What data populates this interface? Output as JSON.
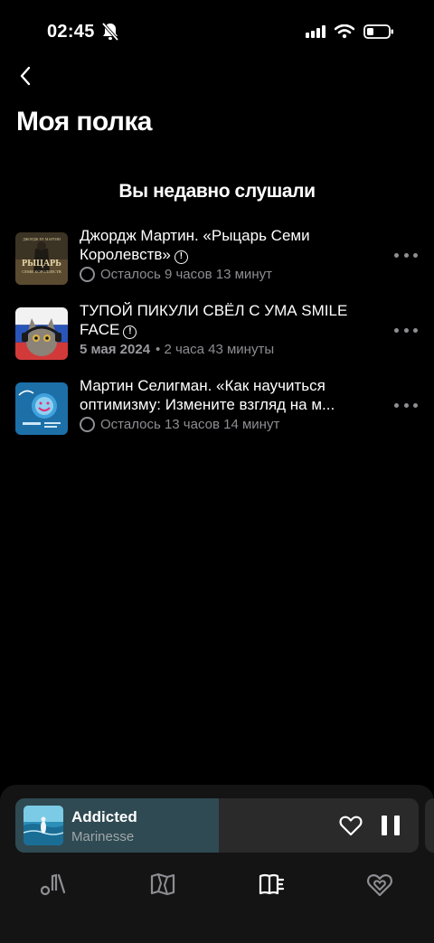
{
  "status_bar": {
    "time": "02:45",
    "icons": [
      "bell-muted-icon",
      "cellular-signal-icon",
      "wifi-icon",
      "battery-icon"
    ]
  },
  "header": {
    "back_icon": "chevron-left-icon",
    "title": "Моя полка"
  },
  "recent": {
    "section_title": "Вы недавно слушали",
    "items": [
      {
        "title": "Джордж Мартин. «Рыцарь Семи Королевств»",
        "has_alert": true,
        "meta_icon": "clock-circle-icon",
        "meta_date": "",
        "meta": "Осталось 9 часов 13 минут",
        "cover_text_top": "ДЖОРДЖ Р.Р. МАРТИН",
        "cover_text_main": "РЫЦАРЬ",
        "cover_text_sub": "СЕМИ КОРОЛЕВСТВ"
      },
      {
        "title": "ТУПОЙ ПИКУЛИ СВЁЛ С УМА SMILE FACE",
        "has_alert": true,
        "meta_icon": "",
        "meta_date": "5 мая 2024",
        "meta": "• 2 часа 43 минуты"
      },
      {
        "title": "Мартин Селигман. «Как научиться оптимизму: Измените взгляд на м...",
        "has_alert": false,
        "meta_icon": "clock-circle-icon",
        "meta_date": "",
        "meta": "Осталось 13 часов 14 минут"
      }
    ]
  },
  "player": {
    "title": "Addicted",
    "artist": "Marinesse",
    "progress": 0.505,
    "accent": "#2f4a52"
  },
  "tabbar": {
    "tabs": [
      {
        "icon": "music-library-icon",
        "active": false
      },
      {
        "icon": "map-icon",
        "active": false
      },
      {
        "icon": "bookshelf-icon",
        "active": true
      },
      {
        "icon": "heart-collection-icon",
        "active": false
      }
    ]
  }
}
